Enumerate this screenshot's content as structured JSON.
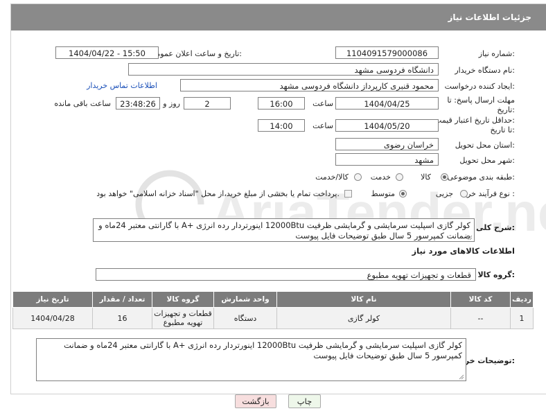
{
  "header": {
    "title": "جزئیات اطلاعات نیاز"
  },
  "form": {
    "need_number": {
      "label": "شماره نیاز:",
      "value": "1104091579000086"
    },
    "announce_datetime": {
      "label": "تاریخ و ساعت اعلان عمومی:",
      "value": "1404/04/22 - 15:50"
    },
    "buyer_org": {
      "label": "نام دستگاه خریدار:",
      "value": "دانشگاه فردوسی مشهد"
    },
    "creator": {
      "label": "ایجاد کننده درخواست:",
      "value": "محمود قنبری کارپرداز دانشگاه فردوسی مشهد",
      "link": "اطلاعات تماس خریدار"
    },
    "deadline": {
      "label_line1": "مهلت ارسال پاسخ: تا",
      "label_line2": "تاریخ:",
      "date": "1404/04/25",
      "time_label": "ساعت",
      "time": "16:00",
      "days": "2",
      "days_label": "روز و",
      "remaining": "23:48:26",
      "remaining_label": "ساعت باقی مانده"
    },
    "price_validity": {
      "label_line1": "حداقل تاریخ اعتبار قیمت:",
      "label_line2": "تا تاریخ:",
      "date": "1404/05/20",
      "time_label": "ساعت",
      "time": "14:00"
    },
    "delivery_province": {
      "label": "استان محل تحویل:",
      "value": "خراسان رضوی"
    },
    "delivery_city": {
      "label": "شهر محل تحویل:",
      "value": "مشهد"
    },
    "category": {
      "label": "طبقه بندی موضوعی:",
      "options": [
        "کالا",
        "خدمت",
        "کالا/خدمت"
      ],
      "selected": "کالا"
    },
    "purchase_process": {
      "label": "نوع فرآیند خرید :",
      "options": [
        "جزیی",
        "متوسط"
      ],
      "selected": "متوسط",
      "payment_note": "پرداخت تمام یا بخشی از مبلغ خرید،از محل \"اسناد خزانه اسلامی\" خواهد بود."
    }
  },
  "description": {
    "label": "شرح کلی نیاز:",
    "text": "کولر گازی اسپلیت سرمایشی و گرمایشی ظرفیت 12000Btu اینورتردار رده انرژی +A با گارانتی معتبر 24ماه و ضمانت کمپرسور 5 سال طبق توضیحات فایل پیوست"
  },
  "goods_section": {
    "title": "اطلاعات کالاهای مورد نیاز",
    "group_label": "گروه کالا:",
    "group_value": "قطعات و تجهیزات تهویه مطبوع"
  },
  "items_table": {
    "headers": [
      "ردیف",
      "کد کالا",
      "نام کالا",
      "واحد شمارش",
      "گروه کالا",
      "تعداد / مقدار",
      "تاریخ نیاز"
    ],
    "rows": [
      {
        "row": "1",
        "code": "--",
        "name": "کولر گازی",
        "unit": "دستگاه",
        "group": "قطعات و تجهیزات تهویه مطبوع",
        "qty": "16",
        "date": "1404/04/28"
      }
    ]
  },
  "buyer_notes": {
    "label": "توضیحات خریدار:",
    "text": "کولر گازی اسپلیت سرمایشی و گرمایشی ظرفیت 12000Btu اینورتردار رده انرژی +A با گارانتی معتبر 24ماه و ضمانت کمپرسور 5 سال طبق توضیحات فایل پیوست"
  },
  "buttons": {
    "print": "چاپ",
    "back": "بازگشت"
  },
  "watermark": {
    "text": "AriaTender.neT"
  },
  "colors": {
    "header_bg": "#8a8a8a",
    "table_header_bg": "#7c7c7c",
    "link": "#1a4fb8",
    "back_button_bg": "#f7dede",
    "print_button_bg": "#eef7ea"
  }
}
